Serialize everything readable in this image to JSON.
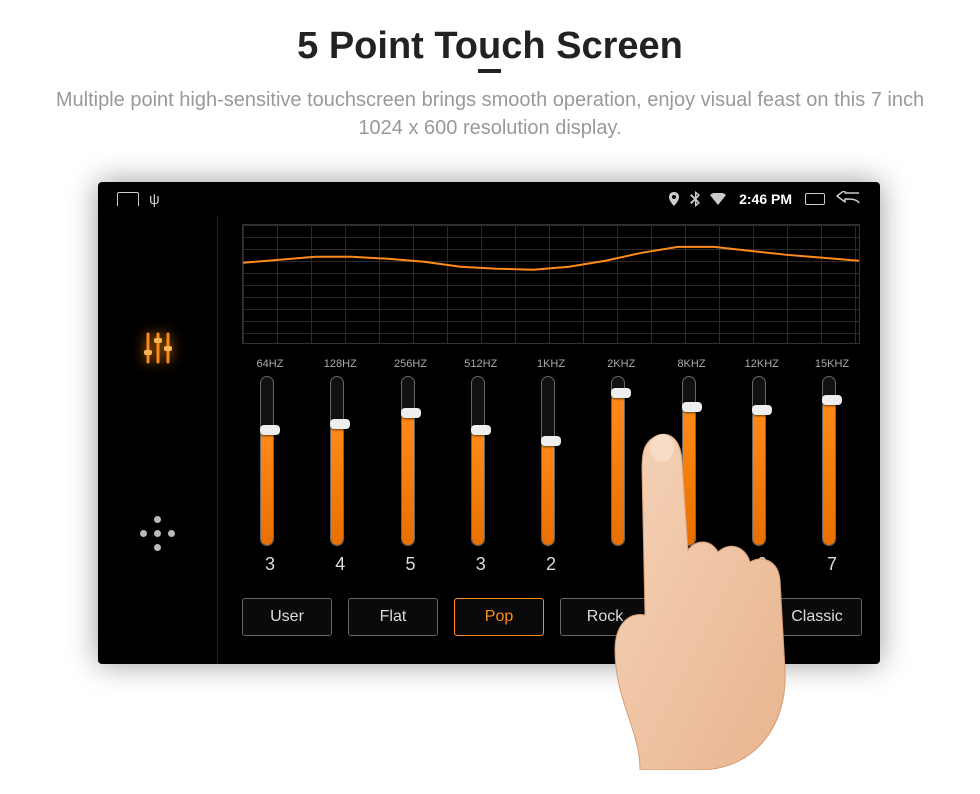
{
  "header": {
    "title_pre": "5 Point To",
    "title_u": "u",
    "title_post": "ch Screen",
    "subtitle": "Multiple point high-sensitive touchscreen brings smooth operation, enjoy visual feast on this 7 inch 1024 x 600 resolution display."
  },
  "statusbar": {
    "time": "2:46 PM"
  },
  "equalizer": {
    "bands": [
      {
        "freq": "64HZ",
        "value": "3",
        "fill_pct": 68
      },
      {
        "freq": "128HZ",
        "value": "4",
        "fill_pct": 72
      },
      {
        "freq": "256HZ",
        "value": "5",
        "fill_pct": 78
      },
      {
        "freq": "512HZ",
        "value": "3",
        "fill_pct": 68
      },
      {
        "freq": "1KHZ",
        "value": "2",
        "fill_pct": 62
      },
      {
        "freq": "2KHZ",
        "value": "",
        "fill_pct": 90
      },
      {
        "freq": "8KHZ",
        "value": "",
        "fill_pct": 82
      },
      {
        "freq": "12KHZ",
        "value": "6",
        "fill_pct": 80
      },
      {
        "freq": "15KHZ",
        "value": "7",
        "fill_pct": 86
      }
    ],
    "graph_points": [
      38,
      35,
      32,
      32,
      34,
      37,
      42,
      44,
      45,
      42,
      36,
      28,
      22,
      22,
      26,
      30,
      33,
      36
    ],
    "presets": [
      {
        "label": "User",
        "active": false
      },
      {
        "label": "Flat",
        "active": false
      },
      {
        "label": "Pop",
        "active": true
      },
      {
        "label": "Rock",
        "active": false
      },
      {
        "label": "",
        "active": false
      },
      {
        "label": "Classic",
        "active": false
      }
    ]
  },
  "colors": {
    "accent": "#ff8a1a"
  }
}
